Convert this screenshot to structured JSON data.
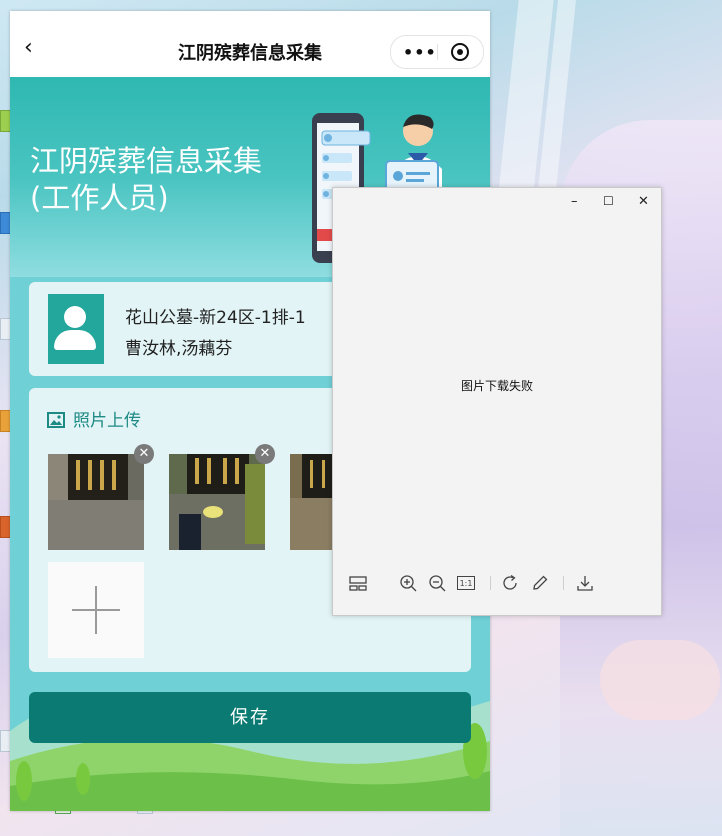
{
  "nav": {
    "back_glyph": "‹",
    "title": "江阴殡葬信息采集",
    "more_glyph": "•••"
  },
  "banner": {
    "title_line1": "江阴殡葬信息采集",
    "title_line2": "(工作人员)"
  },
  "info_card": {
    "cemetery": "花山公墓-新24区-1排-1",
    "names": "曹汝林,汤藕芬",
    "avatar_icon": "person-icon"
  },
  "photo_section": {
    "heading": "照片上传",
    "heading_icon": "image-icon",
    "delete_glyph": "✕",
    "add_icon": "plus-icon",
    "photos": [
      {
        "alt": "tombstone-photo"
      },
      {
        "alt": "tombstone-photo"
      },
      {
        "alt": "tombstone-photo"
      }
    ]
  },
  "save_button": "保存",
  "viewer": {
    "minimize": "–",
    "maximize": "☐",
    "close": "✕",
    "message": "图片下载失败",
    "tools": [
      "thumbnail-icon",
      "zoom-in-icon",
      "zoom-out-icon",
      "actual-size-icon",
      "rotate-icon",
      "edit-icon",
      "download-icon"
    ],
    "actual_size_label": "1:1"
  },
  "colors": {
    "accent": "#0b7a72",
    "banner": "#2fb8b2",
    "avatar": "#23a69c",
    "section_title": "#1e8a84"
  }
}
